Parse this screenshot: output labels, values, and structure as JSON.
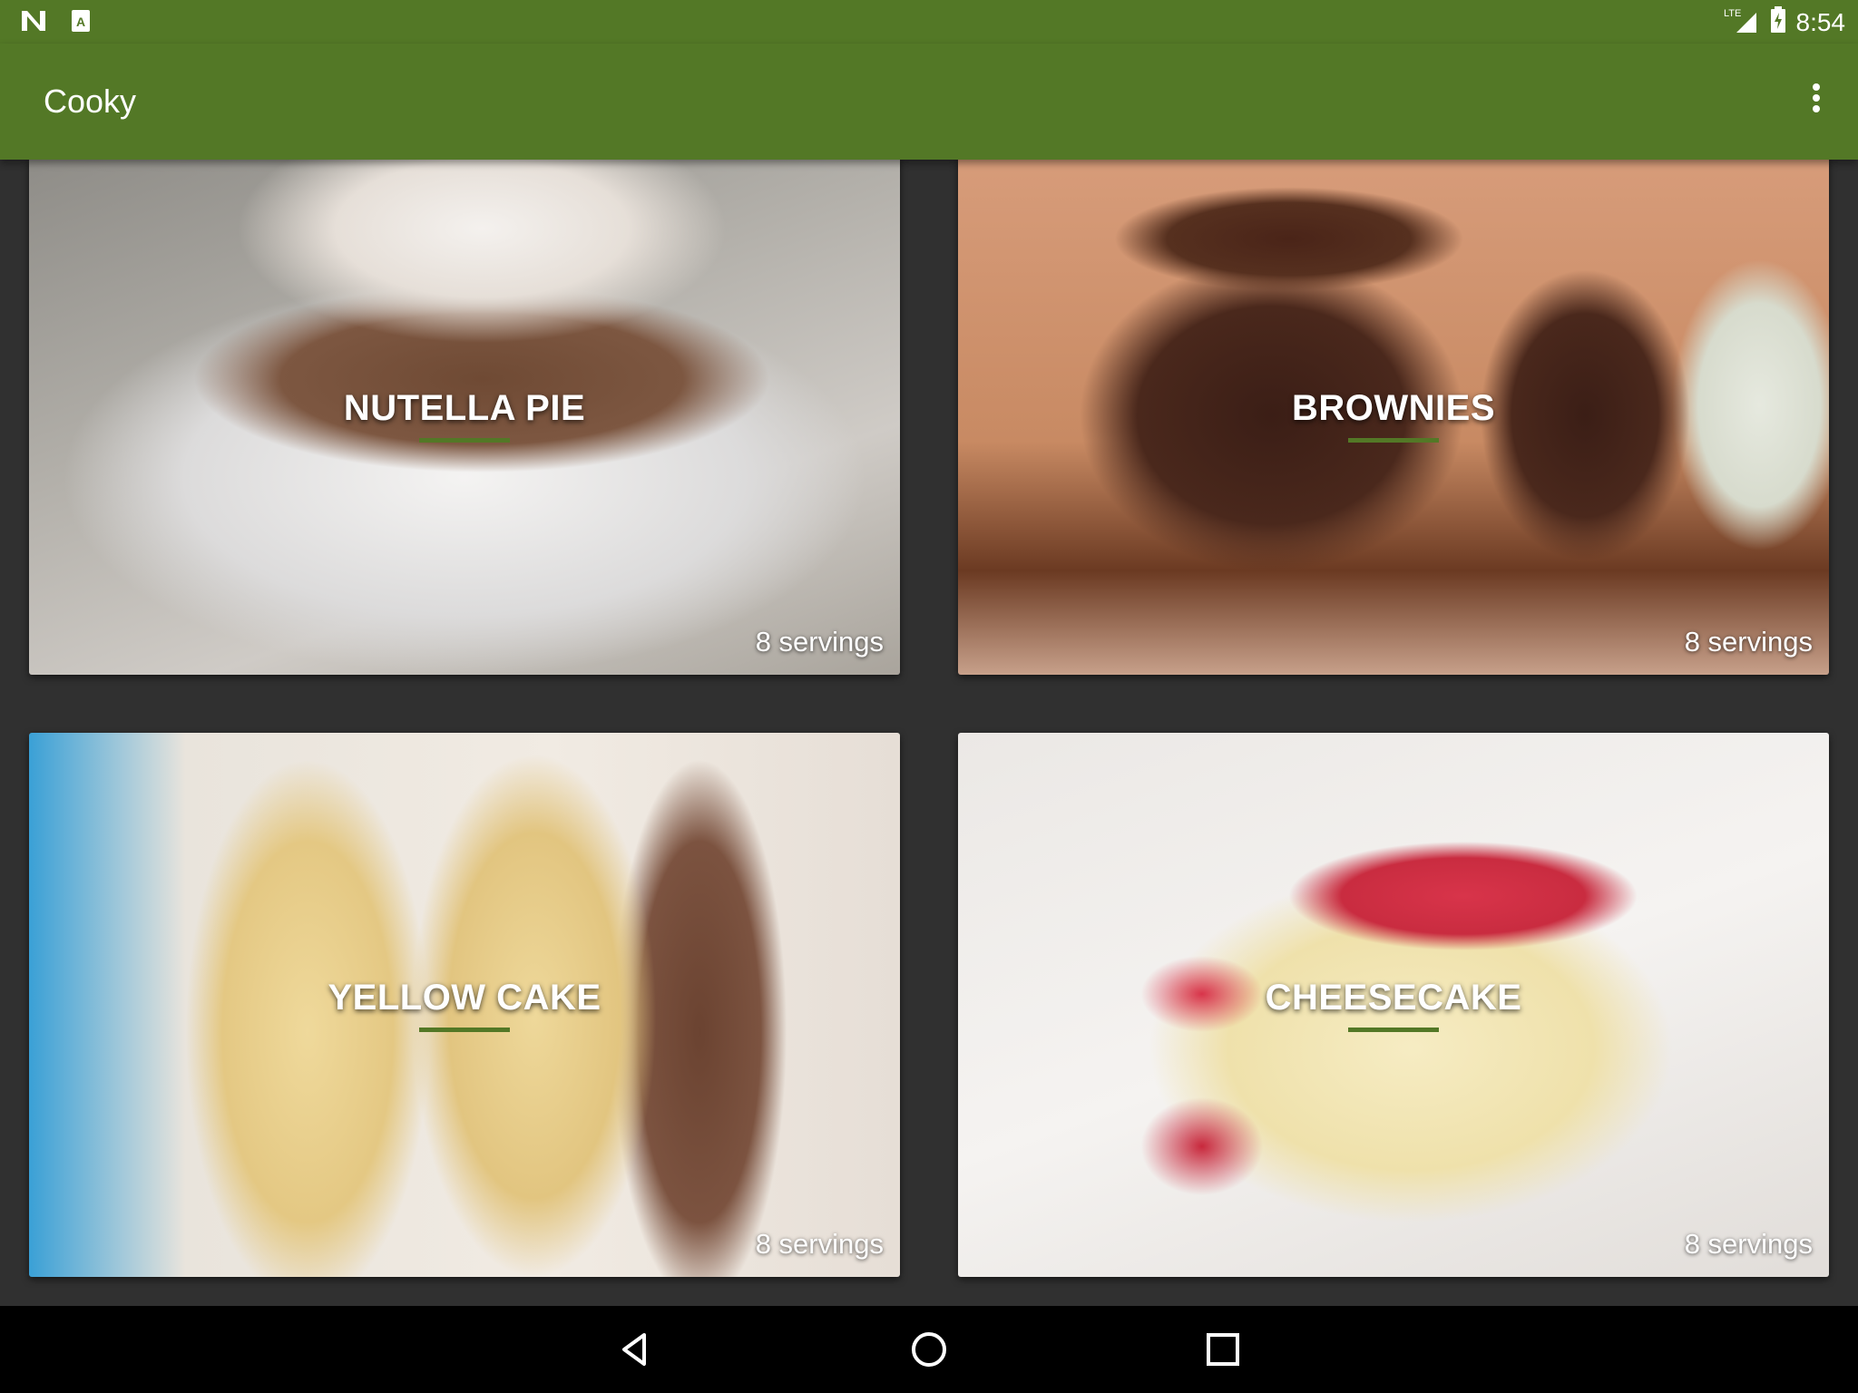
{
  "status_bar": {
    "time": "8:54",
    "network": "LTE",
    "left_icons": [
      "n-icon",
      "app-notification-icon"
    ],
    "right_icons": [
      "lte-signal-icon",
      "battery-charging-icon"
    ]
  },
  "app_bar": {
    "title": "Cooky",
    "menu_icon": "overflow-menu-icon",
    "color": "#537826"
  },
  "recipes": [
    {
      "name": "NUTELLA PIE",
      "servings": "8 servings"
    },
    {
      "name": "BROWNIES",
      "servings": "8 servings"
    },
    {
      "name": "YELLOW CAKE",
      "servings": "8 servings"
    },
    {
      "name": "CHEESECAKE",
      "servings": "8 servings"
    }
  ],
  "nav_bar": {
    "buttons": [
      "back-icon",
      "home-icon",
      "recents-icon"
    ]
  }
}
